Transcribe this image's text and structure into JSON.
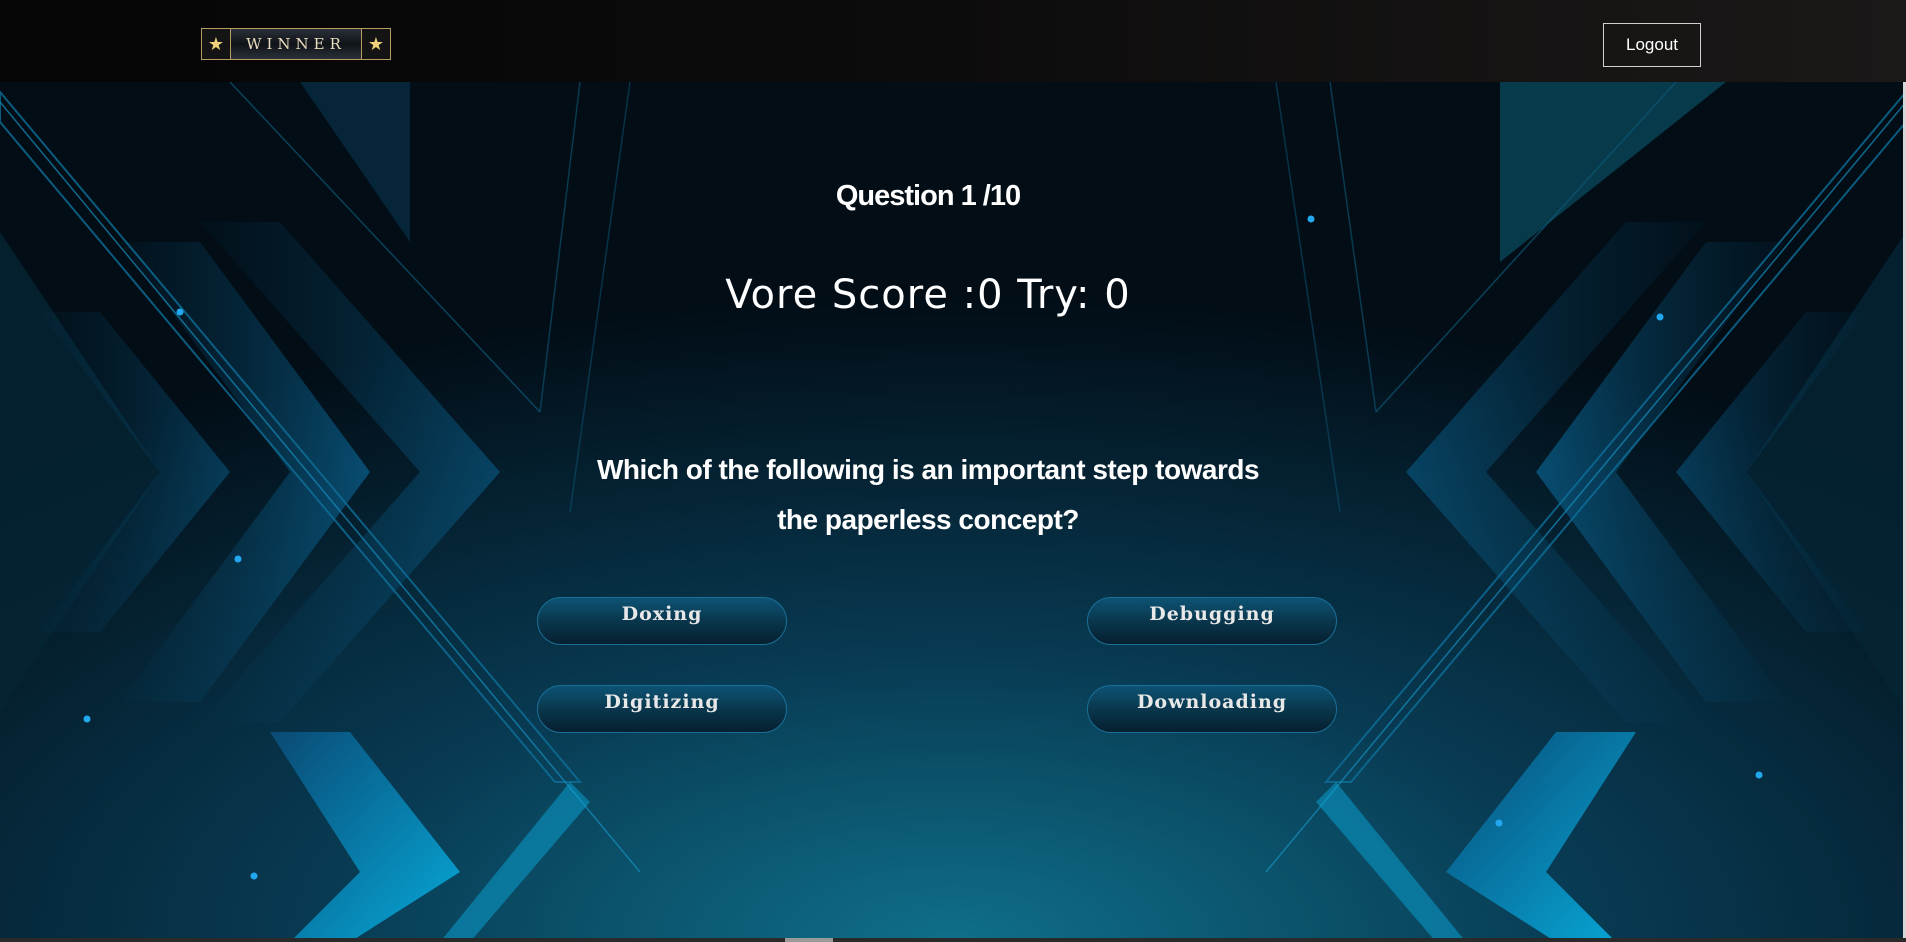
{
  "header": {
    "logo_text": "WINNER",
    "logout_label": "Logout"
  },
  "quiz": {
    "question_counter": "Question 1 /10",
    "score_line": "Vore Score :0 Try: 0",
    "question": "Which of the following is an important step towards the paperless concept?",
    "answers": [
      "Doxing",
      "Debugging",
      "Digitizing",
      "Downloading"
    ]
  },
  "colors": {
    "background_top": "#02121c",
    "background_bottom": "#0a6a86",
    "accent": "#0fb4e8",
    "answer_button": "#0a3a52"
  }
}
